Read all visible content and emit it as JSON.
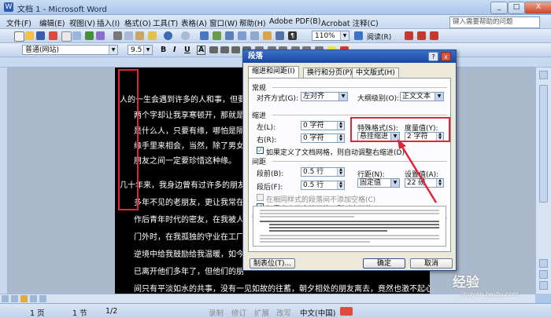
{
  "window": {
    "title": "文档 1 - Microsoft Word",
    "minimize": "_",
    "maximize": "□",
    "close": "X"
  },
  "menu": {
    "items": [
      "文件(F)",
      "编辑(E)",
      "视图(V)",
      "插入(I)",
      "格式(O)",
      "工具(T)",
      "表格(A)",
      "窗口(W)",
      "帮助(H)",
      "Adobe PDF(B)",
      "Acrobat 注释(C)"
    ],
    "help_placeholder": "键入需要帮助的问题"
  },
  "toolbar": {
    "zoom": "110%",
    "read_mode": "阅读(R)",
    "style": "普通(网站)",
    "font_size": "9.5",
    "bold": "B",
    "italic": "I",
    "underline": "U",
    "font_letter": "A"
  },
  "document": {
    "lines": [
      "人的一生会遇到许多的人和事，但要想人",
      "两个字却让我享寒顿开，那就是'随",
      "是什么人，只要有缘，哪怕是隔着千",
      "缘手里来相会，当然，除了男女之间",
      "朋友之间一定要珍惜这种缘。",
      "几十年来，我身边曾有过许多的朋友，",
      "多年不见的老朋友，更让我常在思念",
      "作后青年时代的密友，在我被人叫",
      "门外时，在我孤独的守业在工厂那",
      "逆境中给我鼓励给我温暖，如今几",
      "已离开他们多年了，但他们的朋",
      "间只有平淡如水的共事，没有一见如故的往蓄，朝夕相处的朋友离去，竟然也激不起心中的留"
    ]
  },
  "dialog": {
    "title": "段落",
    "tabs": [
      "缩进和间距(I)",
      "换行和分页(P)",
      "中文版式(H)"
    ],
    "general": {
      "section": "常规",
      "alignment_label": "对齐方式(G):",
      "alignment_value": "左对齐",
      "outline_label": "大纲级别(O):",
      "outline_value": "正文文本"
    },
    "indent": {
      "section": "缩进",
      "left_label": "左(L):",
      "left_value": "0 字符",
      "right_label": "右(R):",
      "right_value": "0 字符",
      "special_label": "特殊格式(S):",
      "special_value": "悬挂缩进",
      "by_label": "度量值(Y):",
      "by_value": "2 字符",
      "grid_check": "如果定义了文档网格，则自动调整右缩进(D)",
      "grid_checked": true
    },
    "spacing": {
      "section": "间距",
      "before_label": "段前(B):",
      "before_value": "0.5 行",
      "after_label": "段后(F):",
      "after_value": "0.5 行",
      "line_label": "行距(N):",
      "line_value": "固定值",
      "at_label": "设置值(A):",
      "at_value": "22 磅",
      "no_space_check": "在相同样式的段落间不添加空格(C)",
      "no_space_checked": false,
      "snap_check": "如果定义了文档网格，则对齐网格(W)",
      "snap_checked": true
    },
    "preview": {
      "section": "预览"
    },
    "buttons": {
      "tabs": "制表位(T)...",
      "ok": "确定",
      "cancel": "取消"
    },
    "check_mark": "✓"
  },
  "status": {
    "page": "1 页",
    "section": "1 节",
    "pages": "1/2",
    "rec": "录制",
    "trk": "修订",
    "ext": "扩展",
    "ovr": "改写",
    "language": "中文(中国)"
  },
  "watermark": {
    "text": "经验",
    "url": "jingyan.baidu.com"
  },
  "colors": {
    "highlight": "#e0243a",
    "dialog_title": "#1a47a0"
  }
}
